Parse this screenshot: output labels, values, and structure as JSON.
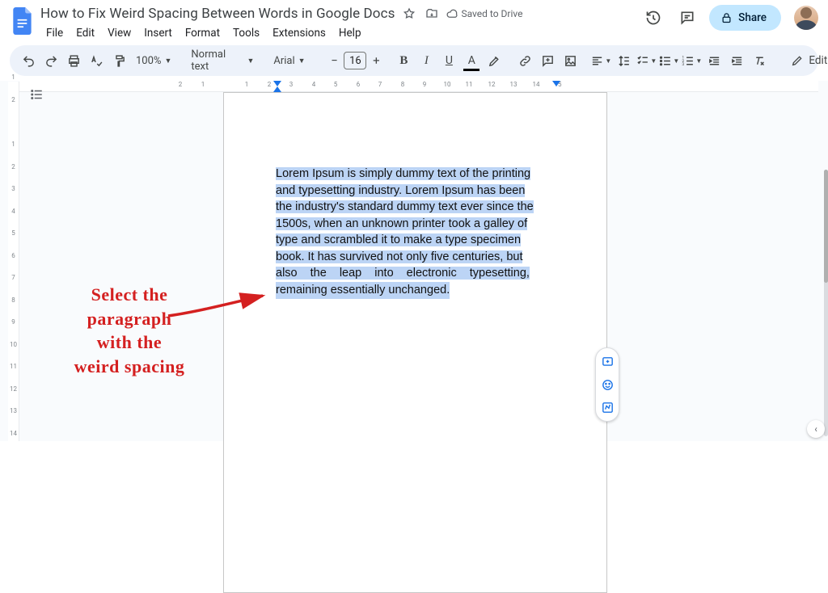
{
  "header": {
    "title": "How to Fix Weird Spacing Between Words in Google Docs",
    "saved_label": "Saved to Drive",
    "share_label": "Share"
  },
  "menu": [
    "File",
    "Edit",
    "View",
    "Insert",
    "Format",
    "Tools",
    "Extensions",
    "Help"
  ],
  "toolbar": {
    "zoom": "100%",
    "style": "Normal text",
    "font": "Arial",
    "font_size": "16",
    "mode": "Editing"
  },
  "ruler": {
    "hticks": [
      "2",
      "1",
      "1",
      "2",
      "3",
      "4",
      "5",
      "6",
      "7",
      "8",
      "9",
      "10",
      "11",
      "12",
      "13",
      "14",
      "15"
    ],
    "vticks": [
      "1",
      "2",
      "1",
      "2",
      "3",
      "4",
      "5",
      "6",
      "7",
      "8",
      "9",
      "10",
      "11",
      "12",
      "13",
      "14"
    ]
  },
  "document": {
    "paragraph_lines": [
      "Lorem Ipsum is simply dummy text of the printing",
      "and typesetting industry. Lorem Ipsum has been",
      "the industry's standard dummy text ever since the",
      "1500s, when an unknown printer took a galley of",
      "type and scrambled it to make a type specimen",
      "book. It has survived not only five centuries, but",
      "also the leap into electronic typesetting,"
    ],
    "paragraph_last": "remaining essentially unchanged."
  },
  "annotation": {
    "line1": "Select the",
    "line2": "paragraph",
    "line3": "with the",
    "line4": "weird spacing"
  }
}
